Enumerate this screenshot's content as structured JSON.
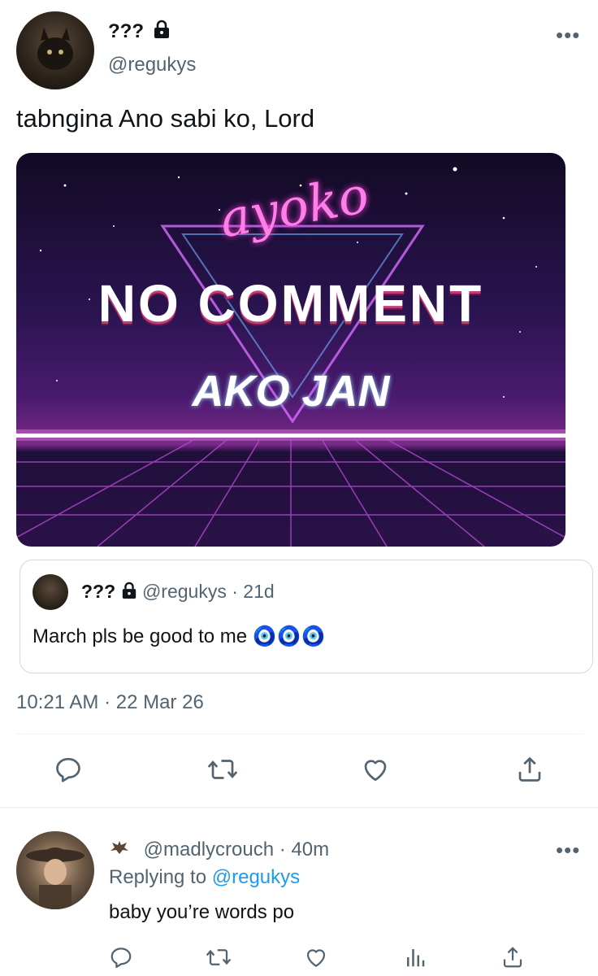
{
  "tweet": {
    "display_name": "???",
    "handle": "@regukys",
    "text": "tabngina Ano sabi ko, Lord",
    "image": {
      "script_text": "ayoko",
      "headline": "NO COMMENT",
      "subline": "AKO JAN"
    },
    "quote": {
      "display_name": "???",
      "handle": "@regukys",
      "sep": "·",
      "time": "21d",
      "text": "March pls be good to me 🧿🧿🧿"
    },
    "timestamp": "10:21 AM · 22 Mar 26"
  },
  "reply": {
    "handle": "@madlycrouch",
    "sep": "·",
    "time": "40m",
    "replying_prefix": "Replying to",
    "replying_handle": "@regukys",
    "text": "baby you’re words po"
  },
  "icons": {
    "more": "more-dots-icon",
    "lock": "lock-icon",
    "reply": "reply-icon",
    "retweet": "retweet-icon",
    "like": "heart-icon",
    "share": "share-icon",
    "analytics": "analytics-icon",
    "bat": "bat-emoji-icon"
  },
  "colors": {
    "link": "#1d9bf0",
    "muted": "#536471",
    "text": "#0f1419",
    "border": "#eff3f4"
  }
}
